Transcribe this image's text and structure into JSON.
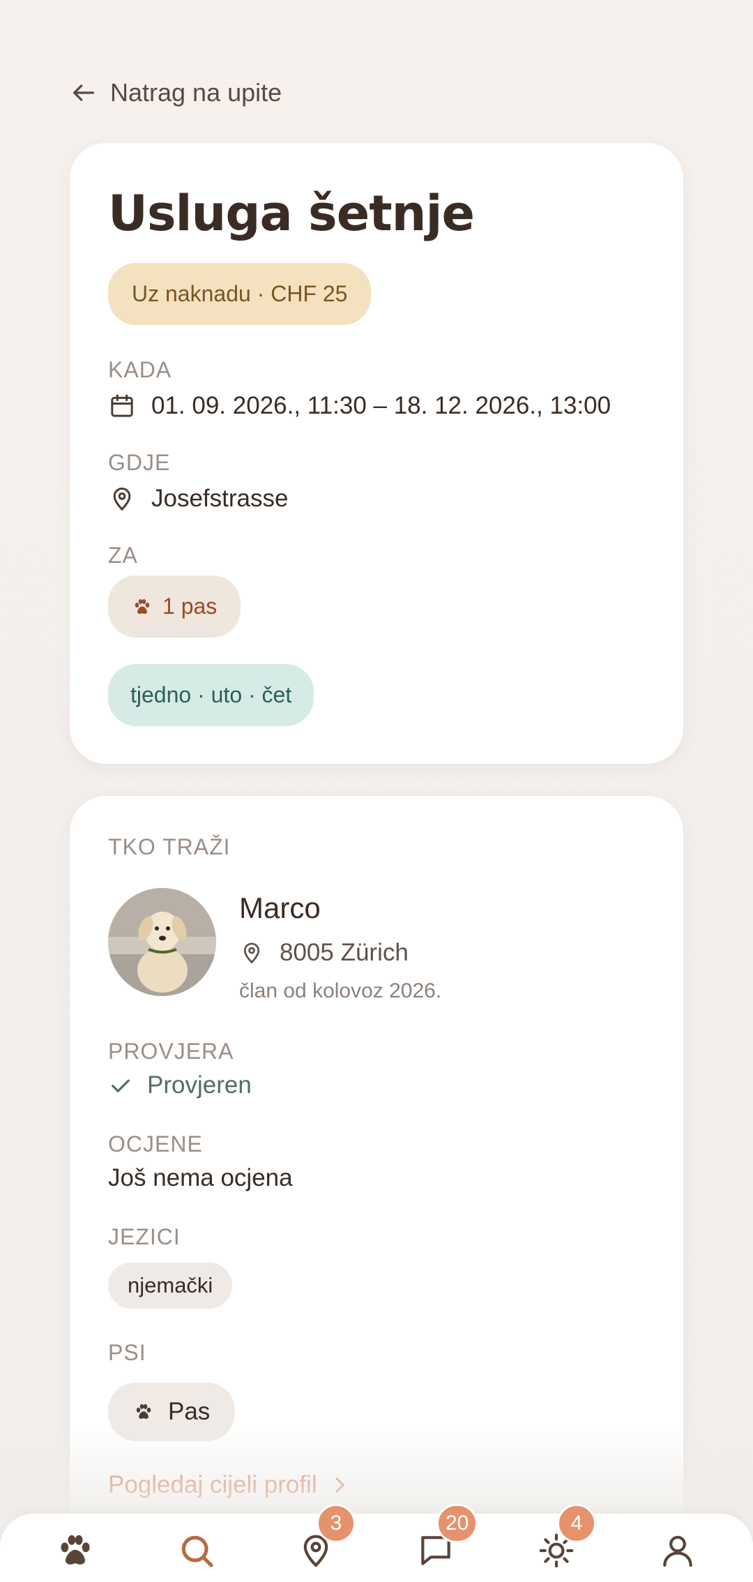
{
  "back": {
    "label": "Natrag na upite"
  },
  "request": {
    "title": "Usluga šetnje",
    "price_badge": "Uz naknadu · CHF 25",
    "when_label": "KADA",
    "when_value": "01. 09. 2026., 11:30 – 18. 12. 2026., 13:00",
    "where_label": "GDJE",
    "where_value": "Josefstrasse",
    "for_label": "ZA",
    "for_value": "1 pas",
    "schedule": "tjedno · uto · čet"
  },
  "requester": {
    "section_label": "TKO TRAŽI",
    "name": "Marco",
    "city": "8005 Zürich",
    "member_since": "član od kolovoz 2026.",
    "verification_label": "PROVJERA",
    "verification_value": "Provjeren",
    "ratings_label": "OCJENE",
    "ratings_value": "Još nema ocjena",
    "languages_label": "JEZICI",
    "languages": [
      "njemački"
    ],
    "dogs_label": "PSI",
    "dogs": [
      "Pas"
    ],
    "profile_link": "Pogledaj cijeli profil"
  },
  "nav": {
    "items": [
      {
        "icon": "paw-icon"
      },
      {
        "icon": "search-icon"
      },
      {
        "icon": "map-pin-icon",
        "badge": "3"
      },
      {
        "icon": "chat-icon",
        "badge": "20"
      },
      {
        "icon": "sun-icon",
        "badge": "4"
      },
      {
        "icon": "user-icon"
      }
    ]
  },
  "colors": {
    "accent": "#d47f5a",
    "badge": "#e5926d",
    "price_bg": "#f4e1c0",
    "schedule_bg": "#d6ebe6",
    "verified": "#4f6e66"
  }
}
